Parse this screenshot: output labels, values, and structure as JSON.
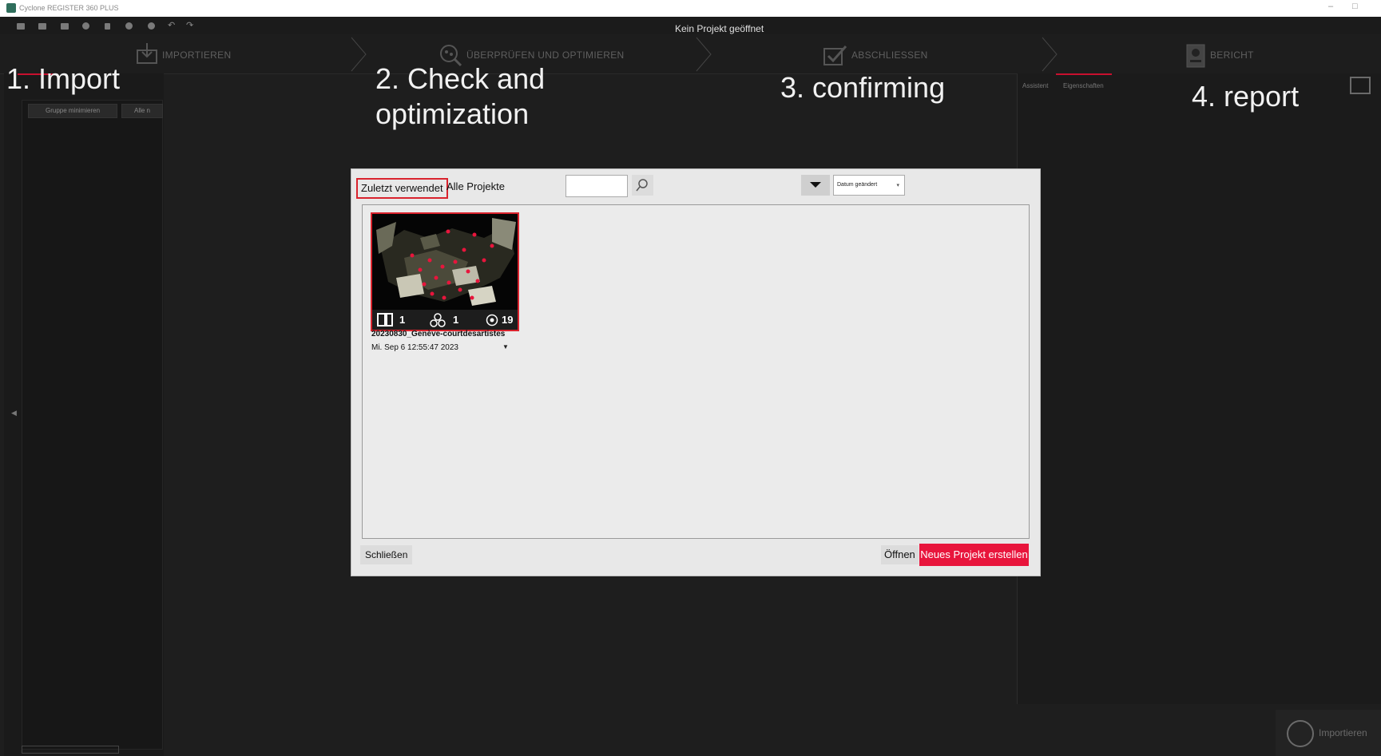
{
  "window": {
    "title": "Cyclone REGISTER 360 PLUS",
    "minimize_glyph": "–",
    "maximize_glyph": "□"
  },
  "toolbar": {
    "status_text": "Kein Projekt geöffnet",
    "icons": [
      "folder-open-icon",
      "archive-icon",
      "layers-icon",
      "gear-icon",
      "database-icon",
      "help-icon",
      "info-icon",
      "undo-icon",
      "redo-icon"
    ]
  },
  "workflow": {
    "steps": [
      {
        "label": "IMPORTIEREN",
        "icon": "import-icon"
      },
      {
        "label": "ÜBERPRÜFEN UND OPTIMIEREN",
        "icon": "review-icon"
      },
      {
        "label": "ABSCHLIESSEN",
        "icon": "check-icon"
      },
      {
        "label": "BERICHT",
        "icon": "report-icon"
      }
    ]
  },
  "left_panel": {
    "buttons": [
      "Gruppe minimieren",
      "Alle n"
    ]
  },
  "right_panel": {
    "tabs": [
      "Assistent",
      "Eigenschaften"
    ]
  },
  "import_button": {
    "label": "Importieren"
  },
  "annotations": {
    "step1": "1.   Import",
    "step2": "2. Check and\noptimization",
    "step3": "3. confirming",
    "step4": "4. report"
  },
  "dialog": {
    "tabs": {
      "recent": "Zuletzt verwendet",
      "all": "Alle Projekte"
    },
    "search": {
      "placeholder": ""
    },
    "sort": {
      "value": "Datum geändert"
    },
    "projects": [
      {
        "name": "20230830_Genève-courtdesartistes",
        "date": "Mi. Sep 6 12:55:47 2023",
        "stats": {
          "setups": "1",
          "links": "1",
          "targets": "19"
        }
      }
    ],
    "close_label": "Schließen",
    "open_label": "Öffnen",
    "new_label": "Neues Projekt erstellen"
  },
  "colors": {
    "accent": "#e8153c",
    "background": "#1e1e1e"
  }
}
